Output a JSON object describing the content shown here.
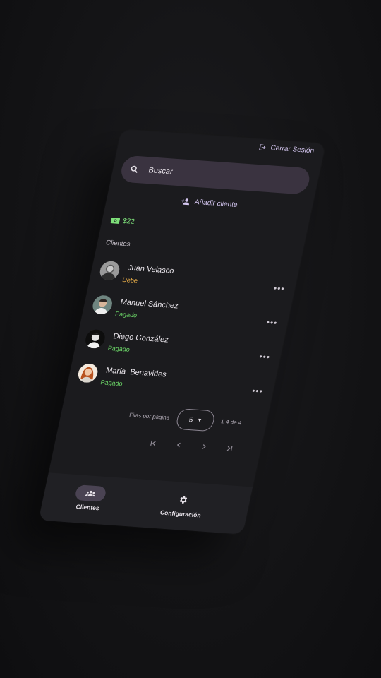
{
  "header": {
    "logout_label": "Cerrar Sesión"
  },
  "search": {
    "placeholder": "Buscar"
  },
  "actions": {
    "add_client_label": "Añadir cliente"
  },
  "balance": {
    "amount": "$22"
  },
  "clients_section": {
    "title": "Clientes"
  },
  "clients": [
    {
      "name": "Juan Velasco",
      "status": "Debe",
      "status_type": "debe"
    },
    {
      "name": "Manuel Sánchez",
      "status": "Pagado",
      "status_type": "pagado"
    },
    {
      "name": "Diego González",
      "status": "Pagado",
      "status_type": "pagado"
    },
    {
      "name": "María  Benavides",
      "status": "Pagado",
      "status_type": "pagado"
    }
  ],
  "pagination": {
    "rows_per_page_label": "Filas por página",
    "rows_per_page_value": "5",
    "range_label": "1-4 de 4"
  },
  "bottom_nav": {
    "items": [
      {
        "label": "Clientes",
        "icon": "group-icon",
        "active": true
      },
      {
        "label": "Configuración",
        "icon": "gear-icon",
        "active": false
      }
    ]
  },
  "colors": {
    "accent": "#d4c6f0",
    "debe": "#f0b34a",
    "pagado": "#6edc6a",
    "surface": "#1b1b1e",
    "search_bg": "#3a3340"
  }
}
